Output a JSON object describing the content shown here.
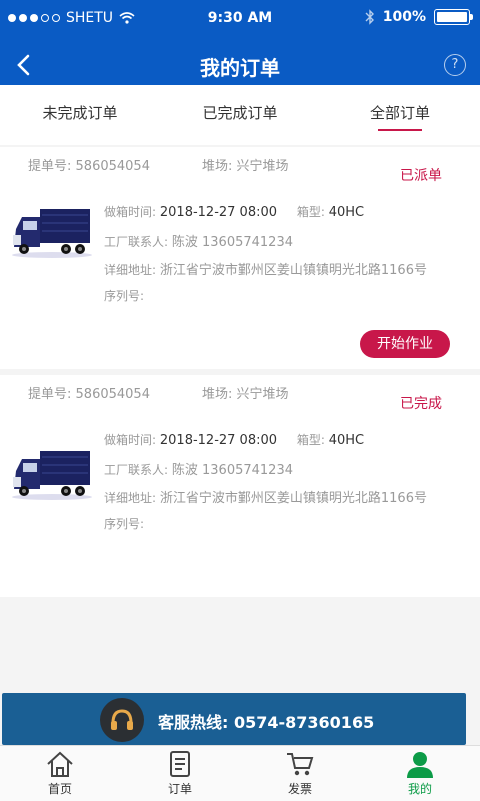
{
  "status_bar": {
    "carrier": "SHETU",
    "time": "9:30 AM",
    "battery": "100%"
  },
  "nav": {
    "title": "我的订单"
  },
  "tabs": [
    {
      "label": "未完成订单"
    },
    {
      "label": "已完成订单"
    },
    {
      "label": "全部订单"
    }
  ],
  "orders": [
    {
      "order_no_label": "提单号:",
      "order_no": "586054054",
      "yard_label": "堆场:",
      "yard": "兴宁堆场",
      "status": "已派单",
      "time_label": "做箱时间:",
      "time": "2018-12-27 08:00",
      "box_label": "箱型:",
      "box": "40HC",
      "contact_label": "工厂联系人:",
      "contact": "陈波 13605741234",
      "address_label": "详细地址:",
      "address": "浙江省宁波市鄞州区姜山镇镇明光北路1166号",
      "serial_label": "序列号:",
      "serial": "",
      "action": "开始作业"
    },
    {
      "order_no_label": "提单号:",
      "order_no": "586054054",
      "yard_label": "堆场:",
      "yard": "兴宁堆场",
      "status": "已完成",
      "time_label": "做箱时间:",
      "time": "2018-12-27 08:00",
      "box_label": "箱型:",
      "box": "40HC",
      "contact_label": "工厂联系人:",
      "contact": "陈波 13605741234",
      "address_label": "详细地址:",
      "address": "浙江省宁波市鄞州区姜山镇镇明光北路1166号",
      "serial_label": "序列号:",
      "serial": ""
    }
  ],
  "hotline": {
    "text": "客服热线:  0574-87360165"
  },
  "tabbar": [
    {
      "label": "首页",
      "icon": "home-icon"
    },
    {
      "label": "订单",
      "icon": "order-icon"
    },
    {
      "label": "发票",
      "icon": "cart-icon"
    },
    {
      "label": "我的",
      "icon": "user-icon"
    }
  ],
  "colors": {
    "primary": "#0a5bc4",
    "accent": "#c8174a",
    "hotline_bg": "#1a5f94",
    "active_tab": "#0c9b47"
  }
}
